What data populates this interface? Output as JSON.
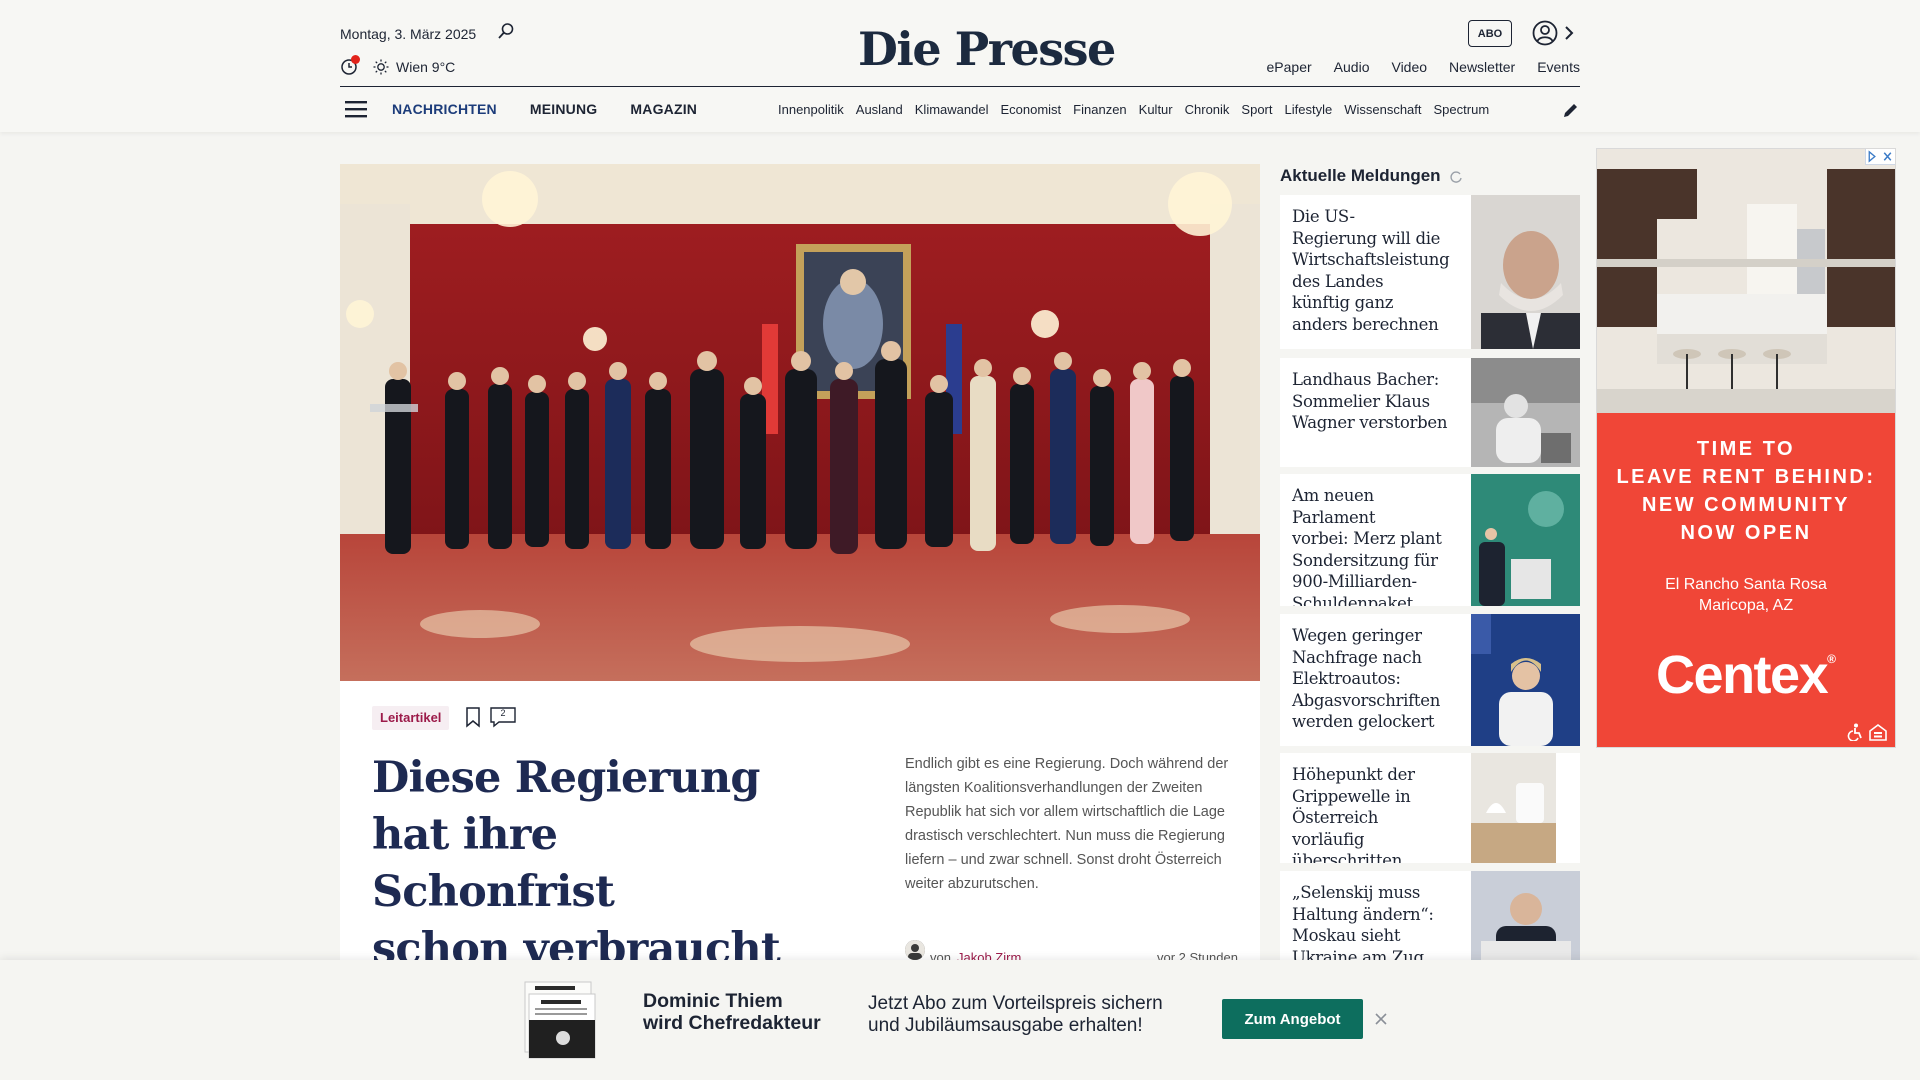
{
  "header": {
    "date": "Montag, 3. März 2025",
    "weather": "Wien 9°C",
    "logo": "Die Presse",
    "abo_label": "ABO",
    "top_links": [
      "ePaper",
      "Audio",
      "Video",
      "Newsletter",
      "Events"
    ],
    "main_nav": [
      "NACHRICHTEN",
      "MEINUNG",
      "MAGAZIN"
    ],
    "sub_nav": [
      "Innenpolitik",
      "Ausland",
      "Klimawandel",
      "Economist",
      "Finanzen",
      "Kultur",
      "Chronik",
      "Sport",
      "Lifestyle",
      "Wissenschaft",
      "Spectrum"
    ]
  },
  "hero": {
    "tag": "Leitartikel",
    "comment_count": "2",
    "title_lines": [
      "Diese Regierung",
      "hat ihre Schonfrist",
      "schon verbraucht"
    ],
    "lead": "Endlich gibt es eine Regierung. Doch während der längsten Koalitionsverhandlungen der Zweiten Republik hat sich vor allem wirtschaftlich die Lage drastisch verschlechtert. Nun muss die Regierung liefern – und zwar schnell. Sonst droht Österreich weiter abzurutschen.",
    "author_prefix": "von",
    "author": "Jakob Zirm",
    "time": "vor 2 Stunden"
  },
  "news": {
    "heading": "Aktuelle Meldungen",
    "items": [
      {
        "lines": [
          "Die US-",
          "Regierung will die",
          "Wirtschaftsleistung",
          "des Landes",
          "künftig ganz",
          "anders berechnen"
        ]
      },
      {
        "lines": [
          "Landhaus Bacher:",
          "Sommelier Klaus",
          "Wagner verstorben"
        ]
      },
      {
        "lines": [
          "Am neuen Parlament",
          "vorbei: Merz plant",
          "Sondersitzung für",
          "900-Milliarden-",
          "Schuldenpaket"
        ]
      },
      {
        "lines": [
          "Wegen geringer",
          "Nachfrage nach",
          "Elektroautos:",
          "Abgasvorschriften",
          "werden gelockert"
        ]
      },
      {
        "lines": [
          "Höhepunkt der",
          "Grippewelle in",
          "Österreich vorläufig",
          "überschritten"
        ]
      },
      {
        "lines": [
          "„Selenskij muss",
          "Haltung ändern“:",
          "Moskau sieht",
          "Ukraine am Zug"
        ]
      }
    ]
  },
  "ad": {
    "headline_lines": [
      "TIME TO",
      "LEAVE RENT BEHIND:",
      "NEW COMMUNITY",
      "NOW OPEN"
    ],
    "location_lines": [
      "El Rancho Santa Rosa",
      "Maricopa, AZ"
    ],
    "brand": "Centex",
    "brand_mark": "®"
  },
  "promo": {
    "left_lines": [
      "Dominic Thiem",
      "wird Chefredakteur"
    ],
    "right_lines": [
      "Jetzt Abo zum Vorteilspreis sichern",
      "und Jubiläumsausgabe erhalten!"
    ],
    "button": "Zum Angebot"
  },
  "colors": {
    "brand_navy": "#1c2a3f",
    "accent_red": "#e2231a",
    "tag_magenta": "#9c1b4a",
    "promo_green": "#0d6e5e",
    "ad_red": "#f04637"
  }
}
